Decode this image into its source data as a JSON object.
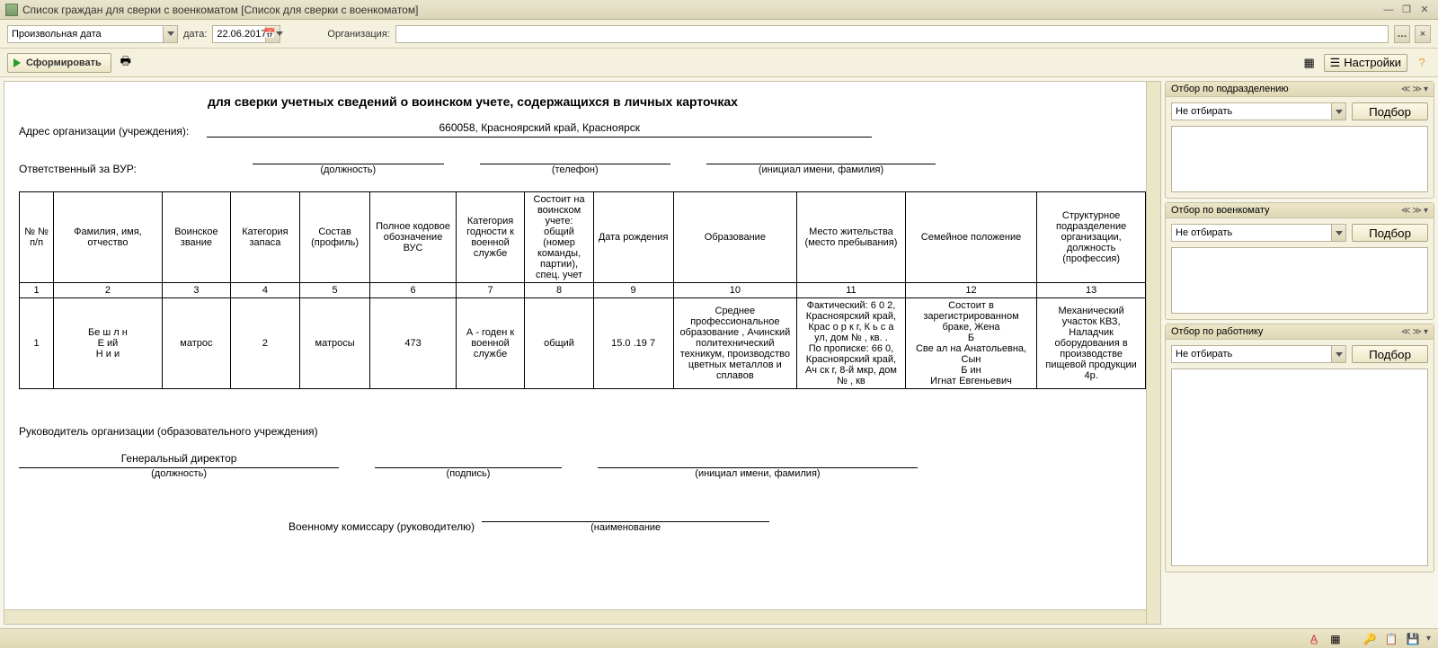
{
  "window": {
    "title": "Список граждан для сверки с военкоматом [Список для сверки с военкоматом]"
  },
  "toolbar": {
    "date_mode": "Произвольная дата",
    "date_label": "дата:",
    "date_value": "22.06.2017",
    "org_label": "Организация:",
    "org_value": ""
  },
  "actions": {
    "run_label": "Сформировать",
    "settings_label": "Настройки"
  },
  "report": {
    "header": "для сверки учетных сведений о воинском учете, содержащихся в личных карточках",
    "address_label": "Адрес организации (учреждения):",
    "address_value": "660058, Красноярский край, Красноярск",
    "vur_label": "Ответственный за ВУР:",
    "hint_position": "(должность)",
    "hint_phone": "(телефон)",
    "hint_initials": "(инициал имени, фамилия)",
    "columns": [
      "№ № п/п",
      "Фамилия, имя, отчество",
      "Воинское звание",
      "Категория запаса",
      "Состав (профиль)",
      "Полное кодовое обозначение ВУС",
      "Категория годности к военной службе",
      "Состоит на воинском учете: общий (номер команды, партии), спец. учет",
      "Дата рождения",
      "Образование",
      "Место жительства (место пребывания)",
      "Семейное положение",
      "Структурное подразделение организации, должность (профессия)"
    ],
    "col_nums": [
      "1",
      "2",
      "3",
      "4",
      "5",
      "6",
      "7",
      "8",
      "9",
      "10",
      "11",
      "12",
      "13"
    ],
    "rows": [
      {
        "n": "1",
        "fio": "Бе ш л н\nЕ   ий\nН  и   и",
        "rank": "матрос",
        "cat": "2",
        "profile": "матросы",
        "vus": "473",
        "fitness": "А - годен к военной службе",
        "account": "общий",
        "dob": "15.0 .19 7",
        "edu": "Среднее профессиональное образование , Ачинский политехнический техникум, производство цветных металлов и сплавов",
        "addr": "Фактический: 6  0 2, Красноярский край, Крас о р к г, К   ь  с а ул, дом №  , кв.  .\nПо прописке: 66   0, Красноярский край, Ач   ск г, 8-й мкр, дом №  , кв",
        "family": "Состоит в зарегистрированном браке, Жена\nБ         \nСве ал на Анатольевна, Сын\nБ         ин\nИгнат Евгеньевич",
        "position": "Механический участок КВЗ, Наладчик оборудования в производстве пищевой продукции 4р."
      }
    ],
    "director_label": "Руководитель организации (образовательного учреждения)",
    "director_position": "Генеральный директор",
    "hint_signature": "(подпись)",
    "commissar_label": "Военному комиссару (руководителю)",
    "hint_name": "(наименование"
  },
  "filters": {
    "dept": {
      "title": "Отбор по подразделению",
      "mode": "Не отбирать",
      "select_label": "Подбор"
    },
    "office": {
      "title": "Отбор по военкомату",
      "mode": "Не отбирать",
      "select_label": "Подбор"
    },
    "worker": {
      "title": "Отбор по работнику",
      "mode": "Не отбирать",
      "select_label": "Подбор"
    }
  }
}
